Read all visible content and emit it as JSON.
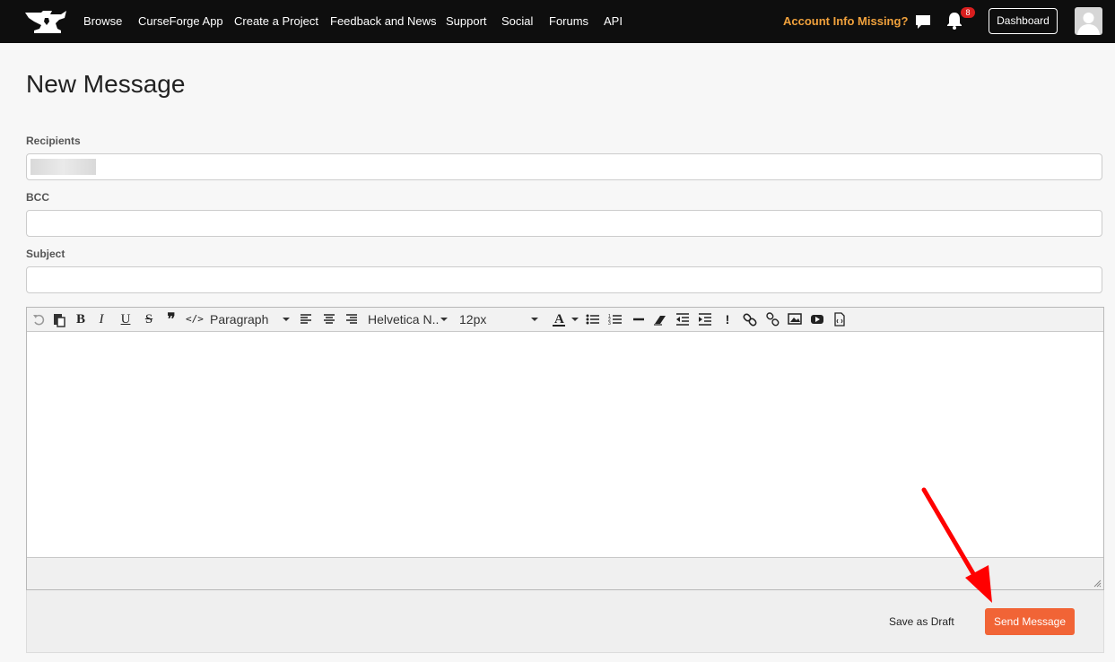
{
  "nav": {
    "links": [
      "Browse",
      "CurseForge App",
      "Create a Project",
      "Feedback and News",
      "Support",
      "Social",
      "Forums",
      "API"
    ],
    "account_warning": "Account Info Missing?",
    "notification_count": "8",
    "dashboard_label": "Dashboard"
  },
  "page": {
    "title": "New Message"
  },
  "form": {
    "recipients_label": "Recipients",
    "bcc_label": "BCC",
    "subject_label": "Subject"
  },
  "editor": {
    "block_format": "Paragraph",
    "font_family": "Helvetica N..",
    "font_size": "12px",
    "toolbar_icons": [
      "undo-icon",
      "paste-icon",
      "bold-icon",
      "italic-icon",
      "underline-icon",
      "strikethrough-icon",
      "blockquote-icon",
      "code-icon",
      "align-left-icon",
      "align-center-icon",
      "align-right-icon",
      "font-color-icon",
      "bullet-list-icon",
      "numbered-list-icon",
      "horizontal-rule-icon",
      "clear-format-icon",
      "outdent-icon",
      "indent-icon",
      "spoiler-icon",
      "link-icon",
      "unlink-icon",
      "image-icon",
      "video-icon",
      "source-code-icon"
    ]
  },
  "actions": {
    "save_draft": "Save as Draft",
    "send": "Send Message"
  },
  "colors": {
    "topbar": "#0e0e0e",
    "warning": "#f0a13c",
    "send_button": "#f16436",
    "badge": "#d81e1e",
    "annotation_arrow": "#ff0000"
  }
}
